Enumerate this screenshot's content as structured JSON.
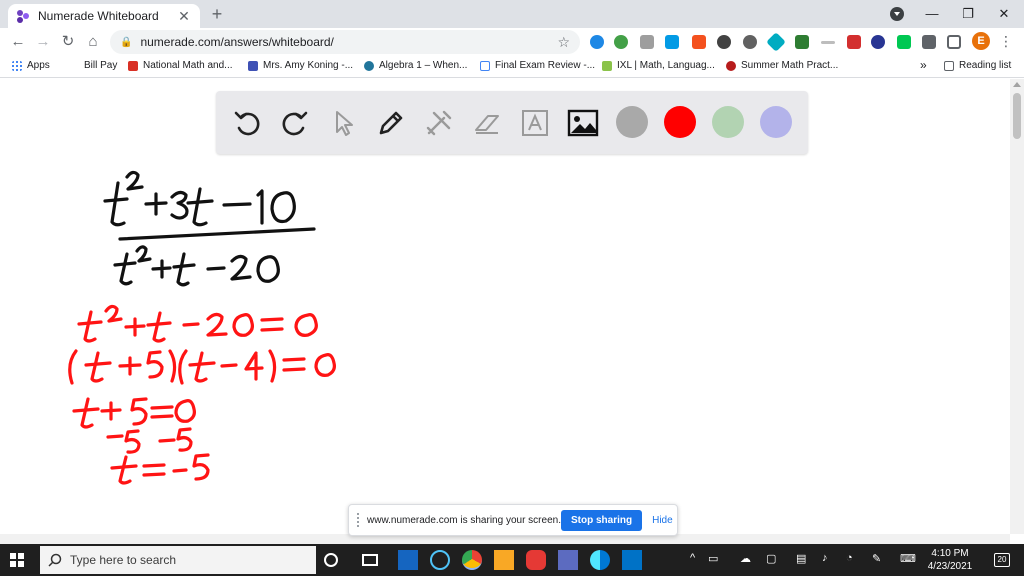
{
  "browser": {
    "tab_title": "Numerade Whiteboard",
    "url": "numerade.com/answers/whiteboard/",
    "profile_initial": "E"
  },
  "bookmarks": {
    "items": [
      {
        "label": "Apps",
        "color": "#4285f4"
      },
      {
        "label": "Bill Pay",
        "color": ""
      },
      {
        "label": "National Math and...",
        "color": "#d93025"
      },
      {
        "label": "Mrs. Amy Koning -...",
        "color": "#3f51b5"
      },
      {
        "label": "Algebra 1 – When...",
        "color": "#21759b"
      },
      {
        "label": "Final Exam Review -...",
        "color": "#4285f4"
      },
      {
        "label": "IXL | Math, Languag...",
        "color": "#8bc34a"
      },
      {
        "label": "Summer Math Pract...",
        "color": "#b71c1c"
      }
    ],
    "overflow": "»",
    "reading_list": "Reading list"
  },
  "whiteboard": {
    "swatch_colors": [
      "#a9a9a9",
      "#ff0000",
      "#b2d3b2",
      "#b3b3ea"
    ],
    "ink_colors": {
      "black": "#111111",
      "red": "#ff1414"
    }
  },
  "sharing": {
    "message": "www.numerade.com is sharing your screen.",
    "stop_label": "Stop sharing",
    "hide_label": "Hide"
  },
  "taskbar": {
    "search_placeholder": "Type here to search",
    "time": "4:10 PM",
    "date": "4/23/2021",
    "notification_count": "20"
  }
}
